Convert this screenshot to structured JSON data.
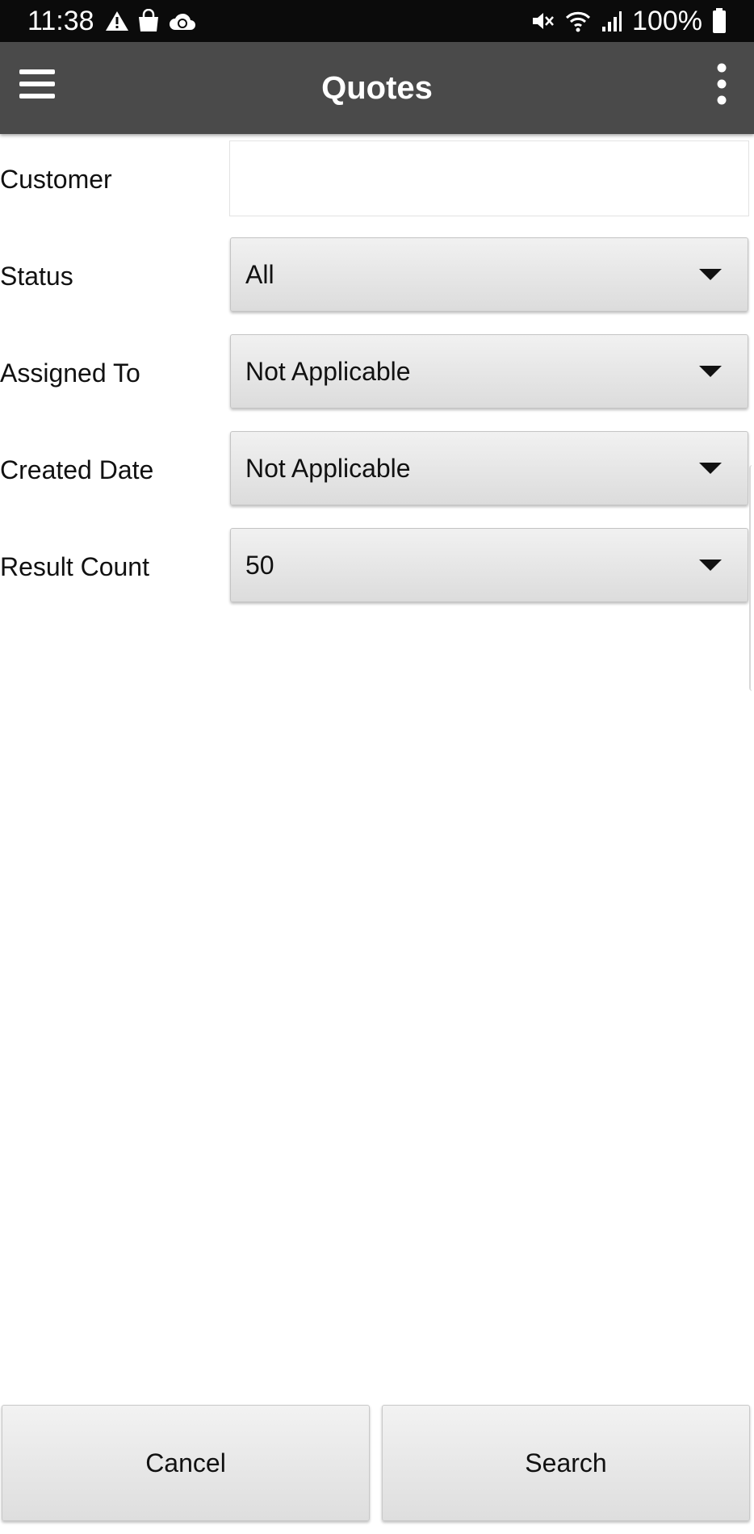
{
  "status_bar": {
    "time": "11:38",
    "left_icons": [
      "warning-icon",
      "shopping-bag-icon",
      "cloud-sync-icon"
    ],
    "right_icons": [
      "mute-icon",
      "wifi-icon",
      "signal-icon",
      "battery-icon"
    ],
    "battery": "100%"
  },
  "app_bar": {
    "title": "Quotes",
    "background": "#4a4a4a"
  },
  "form": {
    "customer": {
      "label": "Customer",
      "value": "",
      "placeholder": ""
    },
    "status": {
      "label": "Status",
      "value": "All"
    },
    "assigned_to": {
      "label": "Assigned To",
      "value": "Not Applicable"
    },
    "created_date": {
      "label": "Created Date",
      "value": "Not Applicable"
    },
    "result_count": {
      "label": "Result Count",
      "value": "50"
    }
  },
  "actions": {
    "cancel_label": "Cancel",
    "search_label": "Search"
  }
}
